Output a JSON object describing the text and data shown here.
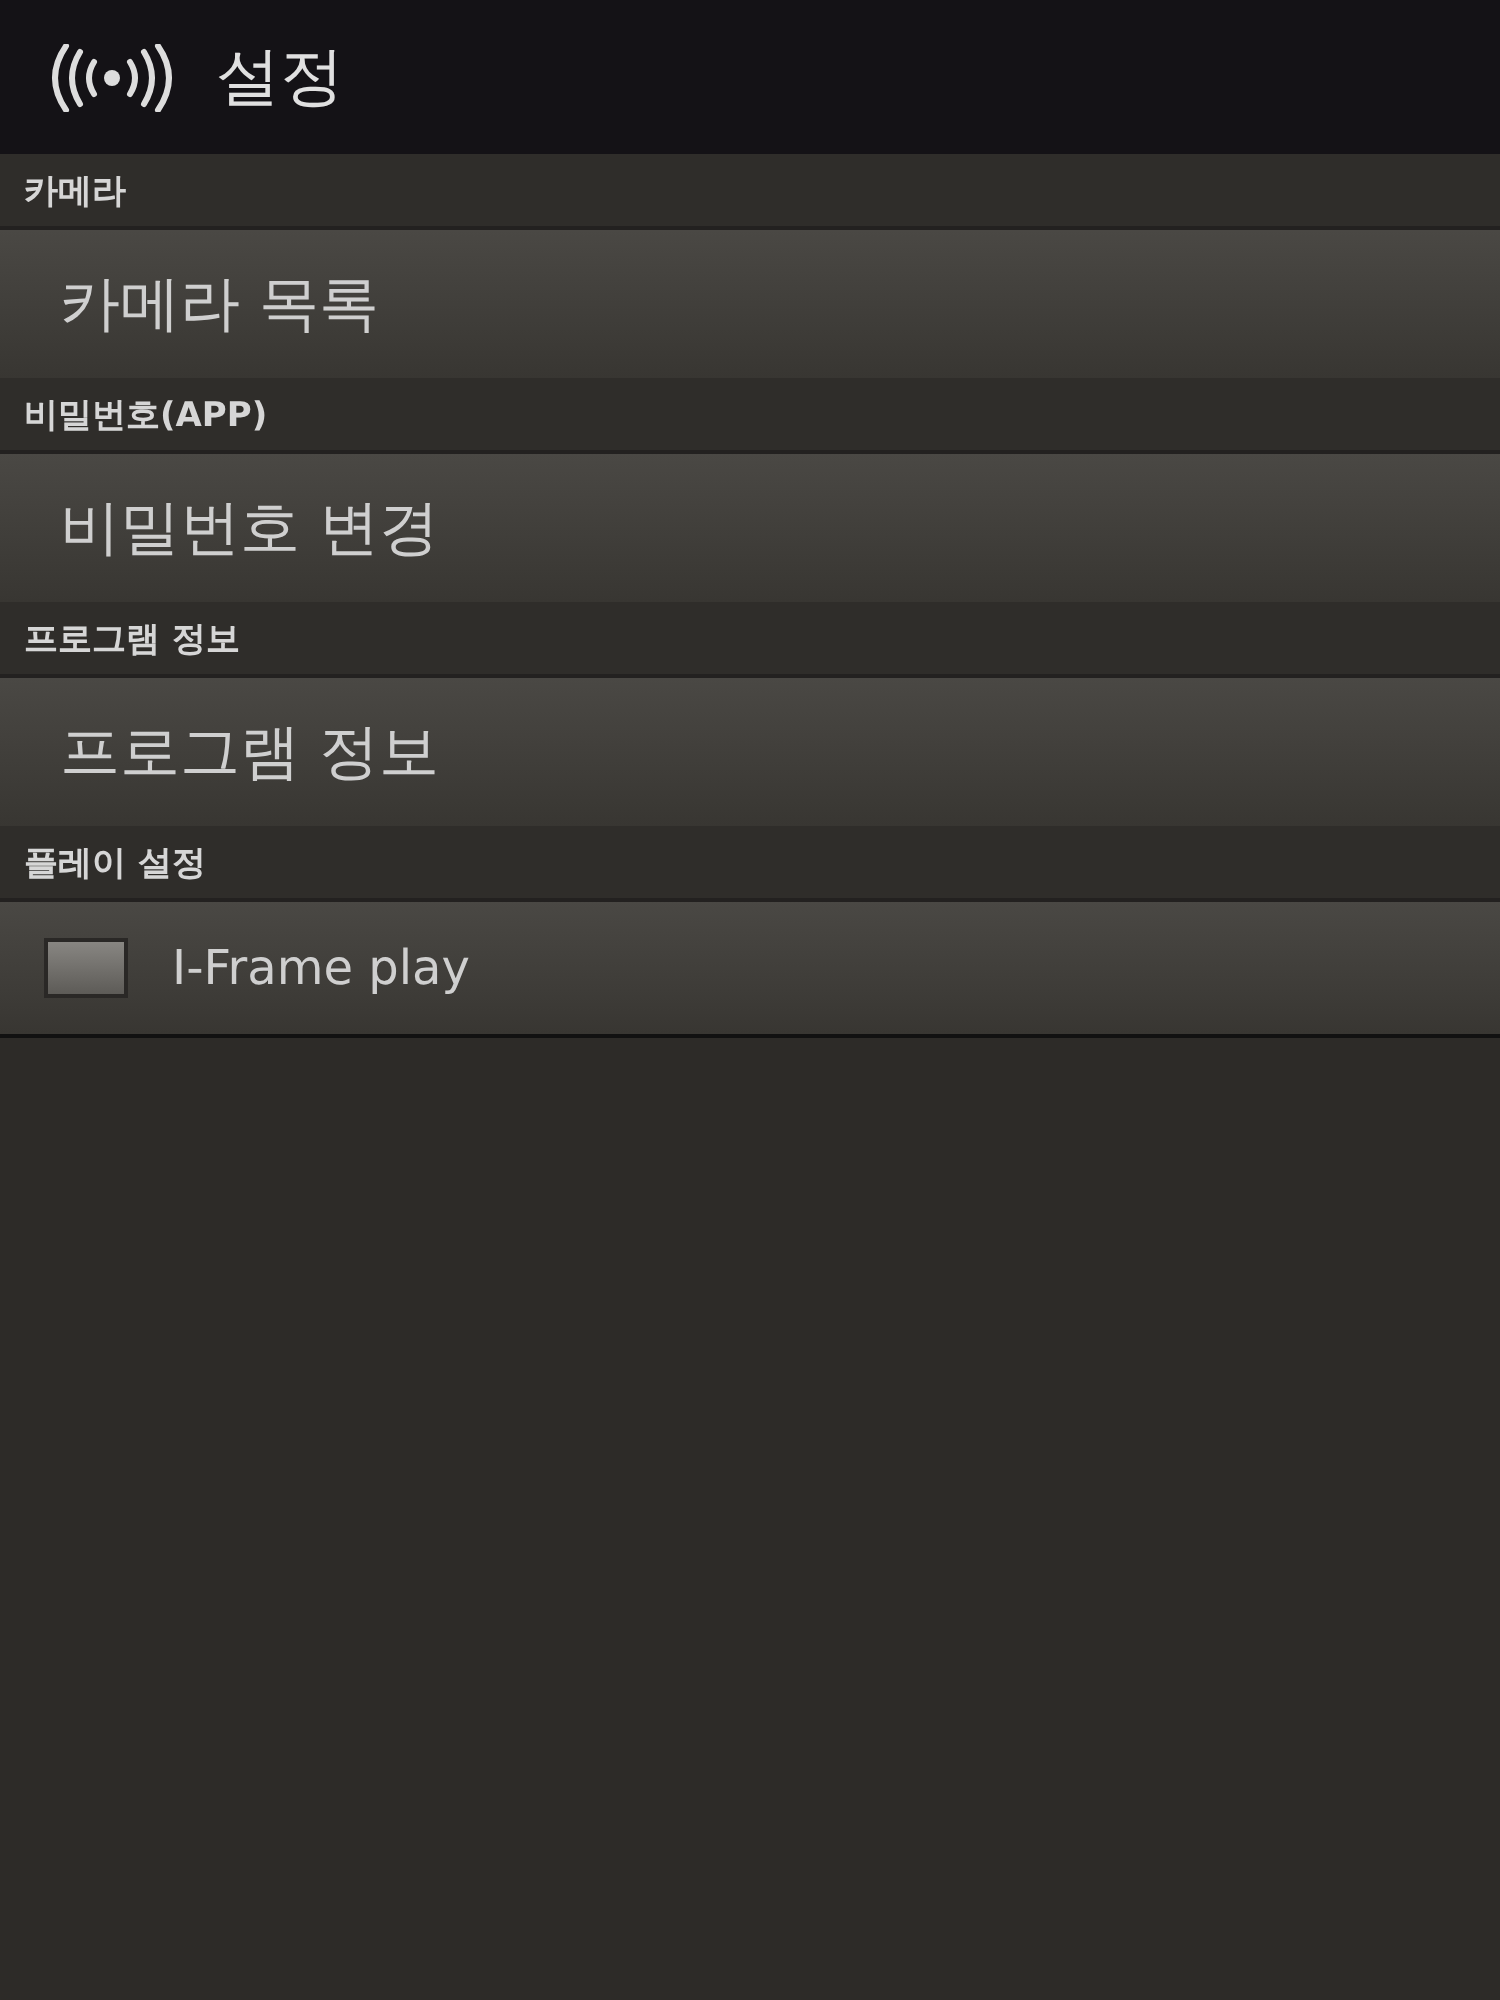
{
  "header": {
    "title": "설정"
  },
  "sections": [
    {
      "title": "카메라",
      "items": [
        {
          "kind": "link",
          "label": "카메라 목록"
        }
      ]
    },
    {
      "title": "비밀번호(APP)",
      "items": [
        {
          "kind": "link",
          "label": "비밀번호 변경"
        }
      ]
    },
    {
      "title": "프로그램 정보",
      "items": [
        {
          "kind": "link",
          "label": "프로그램 정보"
        }
      ]
    },
    {
      "title": "플레이 설정",
      "items": [
        {
          "kind": "checkbox",
          "label": "I-Frame play",
          "checked": false
        }
      ]
    }
  ]
}
